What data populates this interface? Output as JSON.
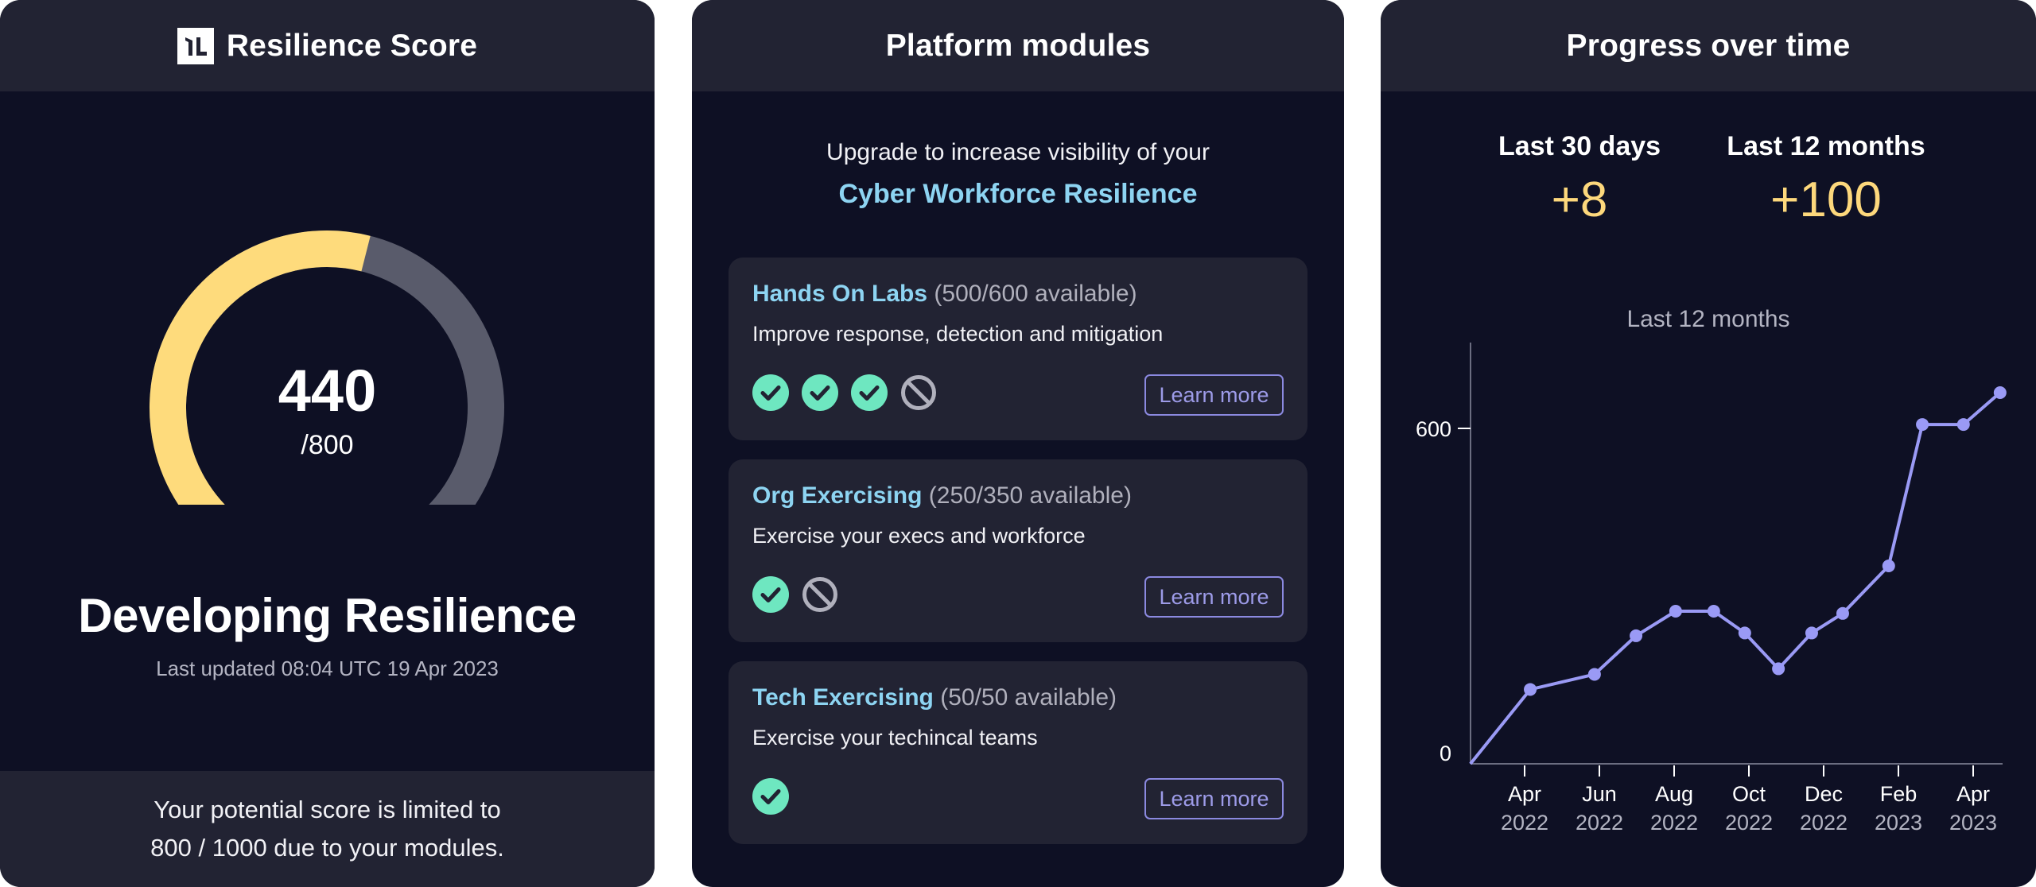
{
  "score_panel": {
    "title": "Resilience Score",
    "logo_icon": "immersive-labs-logo",
    "score": 440,
    "score_label": "440",
    "max_score": 800,
    "max_label": "/800",
    "gauge_fraction": 0.55,
    "status": "Developing Resilience",
    "last_updated": "Last updated 08:04 UTC 19 Apr 2023",
    "footer_line1": "Your potential score is limited to",
    "footer_line2": "800 / 1000 due to your modules.",
    "colors": {
      "gauge_fill": "#fedb7c",
      "gauge_track": "#595b6b"
    }
  },
  "modules_panel": {
    "title": "Platform modules",
    "upgrade_text": "Upgrade to increase visibility of your",
    "upgrade_highlight": "Cyber Workforce Resilience",
    "modules": [
      {
        "name": "Hands On Labs",
        "availability": "(500/600 available)",
        "description": "Improve response, detection and mitigation",
        "statuses": [
          "check-icon",
          "check-icon",
          "check-icon",
          "ban-icon"
        ],
        "button_label": "Learn more"
      },
      {
        "name": "Org Exercising",
        "availability": "(250/350 available)",
        "description": "Exercise your execs and workforce",
        "statuses": [
          "check-icon",
          "ban-icon"
        ],
        "button_label": "Learn more"
      },
      {
        "name": "Tech Exercising",
        "availability": "(50/50 available)",
        "description": "Exercise your techincal teams",
        "statuses": [
          "check-icon"
        ],
        "button_label": "Learn more"
      }
    ],
    "colors": {
      "accent": "#8dd4f2",
      "check": "#6ee7c0",
      "ban": "#b0b0bc",
      "button": "#8b89e0"
    }
  },
  "progress_panel": {
    "title": "Progress over time",
    "stats": [
      {
        "label": "Last 30 days",
        "value": "+8"
      },
      {
        "label": "Last 12 months",
        "value": "+100"
      }
    ],
    "chart_caption": "Last 12 months"
  },
  "chart_data": {
    "type": "line",
    "title": "Last 12 months",
    "xlabel": "",
    "ylabel": "",
    "x_unit": "months since Apr 2022",
    "xlim": [
      -1.45,
      12.8
    ],
    "ylim": [
      0,
      750
    ],
    "y_ticks": [
      0,
      600
    ],
    "y_tick_labels": [
      "0",
      "600"
    ],
    "x_ticks": [
      0,
      2,
      4,
      6,
      8,
      10,
      12
    ],
    "x_tick_labels": [
      [
        "Apr",
        "2022"
      ],
      [
        "Jun",
        "2022"
      ],
      [
        "Aug",
        "2022"
      ],
      [
        "Oct",
        "2022"
      ],
      [
        "Dec",
        "2022"
      ],
      [
        "Feb",
        "2023"
      ],
      [
        "Apr",
        "2023"
      ]
    ],
    "grid": false,
    "series": [
      {
        "name": "Resilience score",
        "color": "#9a9af5",
        "x": [
          -1.45,
          0.15,
          1.87,
          2.98,
          4.04,
          5.06,
          5.89,
          6.79,
          7.68,
          8.51,
          9.74,
          10.64,
          11.74,
          12.72
        ],
        "values": [
          0,
          133,
          160,
          229,
          273,
          273,
          234,
          170,
          234,
          269,
          354,
          607,
          607,
          664
        ],
        "markers": [
          false,
          true,
          true,
          true,
          true,
          true,
          true,
          true,
          true,
          true,
          true,
          true,
          true,
          true
        ]
      }
    ]
  }
}
